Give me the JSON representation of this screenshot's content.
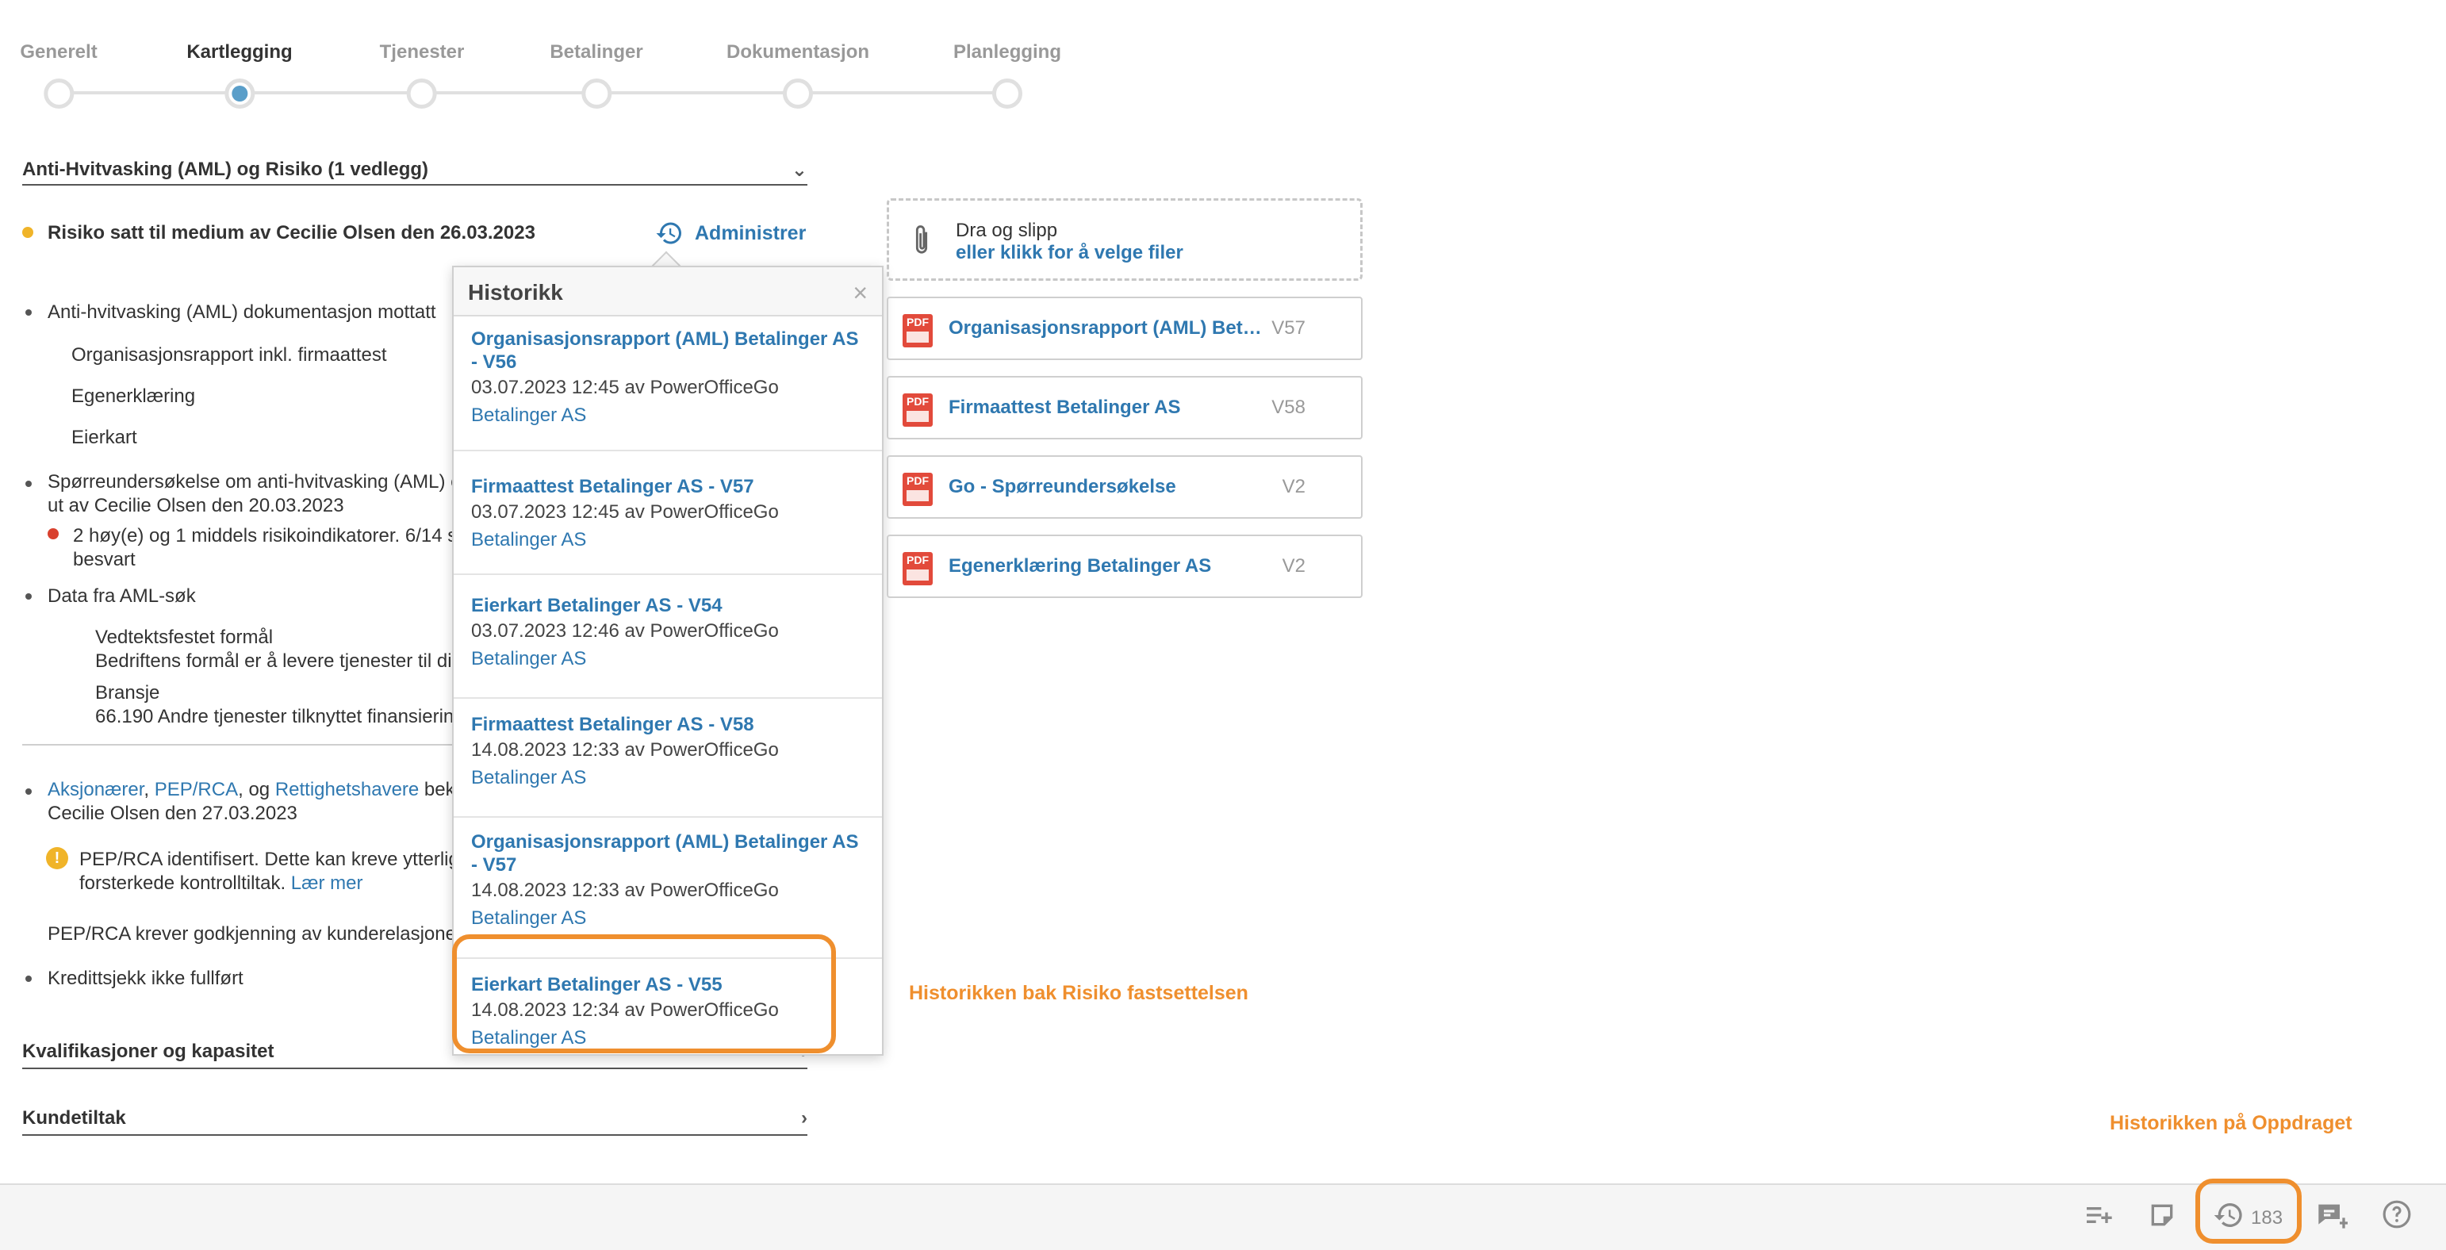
{
  "stepper": {
    "steps": [
      {
        "label": "Generelt"
      },
      {
        "label": "Kartlegging"
      },
      {
        "label": "Tjenester"
      },
      {
        "label": "Betalinger"
      },
      {
        "label": "Dokumentasjon"
      },
      {
        "label": "Planlegging"
      }
    ],
    "active_index": 1
  },
  "sections": {
    "aml_title": "Anti-Hvitvasking (AML) og Risiko (1 vedlegg)",
    "kvalifikasjoner_title": "Kvalifikasjoner og kapasitet",
    "kundetiltak_title": "Kundetiltak"
  },
  "risk": {
    "text": "Risiko satt til medium av Cecilie Olsen den 26.03.2023",
    "admin_label": "Administrer",
    "dot_color": "#f0b429"
  },
  "content": {
    "aml_doc": "Anti-hvitvasking (AML) dokumentasjon mottatt",
    "doc1": "Organisasjonsrapport inkl. firmaattest",
    "doc2": "Egenerklæring",
    "doc3": "Eierkart",
    "survey_line1": "Spørreundersøkelse om anti-hvitvasking (AML) e",
    "survey_line2": "ut av Cecilie Olsen den 20.03.2023",
    "risk_ind_line1": "2 høy(e) og 1 middels risikoindikatorer. 6/14 s",
    "risk_ind_line2": "besvart",
    "aml_search": "Data fra AML-søk",
    "purpose_label": "Vedtektsfestet formål",
    "purpose_value": "Bedriftens formål er å levere tjenester til di",
    "industry_label": "Bransje",
    "industry_value": "66.190 Andre tjenester tilknyttet finansierin",
    "owners_link1": "Aksjonærer",
    "owners_sep1": ", ",
    "owners_link2": "PEP/RCA",
    "owners_sep2": ", og ",
    "owners_link3": "Rettighetshavere",
    "owners_rest": " bek",
    "owners_line2": "Cecilie Olsen den 27.03.2023",
    "pep_warning_line1": "PEP/RCA identifisert. Dette kan kreve ytterlig",
    "pep_warning_line2": "forsterkede kontrolltiltak.",
    "pep_learn_more": "Lær mer",
    "pep_approval": "PEP/RCA krever godkjenning av kunderelasjone",
    "credit_check": "Kredittsjekk ikke fullført"
  },
  "history_popover": {
    "title": "Historikk",
    "items": [
      {
        "title_line1": "Organisasjonsrapport (AML) Betalinger AS",
        "title_line2": "- V56",
        "meta": "03.07.2023 12:45 av PowerOfficeGo",
        "link": "Betalinger AS"
      },
      {
        "title_line1": "Firmaattest Betalinger AS - V57",
        "title_line2": "",
        "meta": "03.07.2023 12:45 av PowerOfficeGo",
        "link": "Betalinger AS"
      },
      {
        "title_line1": "Eierkart Betalinger AS - V54",
        "title_line2": "",
        "meta": "03.07.2023 12:46 av PowerOfficeGo",
        "link": "Betalinger AS"
      },
      {
        "title_line1": "Firmaattest Betalinger AS - V58",
        "title_line2": "",
        "meta": "14.08.2023 12:33 av PowerOfficeGo",
        "link": "Betalinger AS"
      },
      {
        "title_line1": "Organisasjonsrapport (AML) Betalinger AS",
        "title_line2": "- V57",
        "meta": "14.08.2023 12:33 av PowerOfficeGo",
        "link": "Betalinger AS"
      },
      {
        "title_line1": "Eierkart Betalinger AS - V55",
        "title_line2": "",
        "meta": "14.08.2023 12:34 av PowerOfficeGo",
        "link": "Betalinger AS"
      }
    ]
  },
  "dropzone": {
    "line1": "Dra og slipp",
    "line2": "eller klikk for å velge filer"
  },
  "files": [
    {
      "name": "Organisasjonsrapport (AML) Betalinger AS",
      "version": "V57"
    },
    {
      "name": "Firmaattest Betalinger AS",
      "version": "V58"
    },
    {
      "name": "Go - Spørreundersøkelse",
      "version": "V2"
    },
    {
      "name": "Egenerklæring Betalinger AS",
      "version": "V2"
    }
  ],
  "annotations": {
    "risk_history": "Historikken bak Risiko fastsettelsen",
    "assignment_history": "Historikken på Oppdraget",
    "highlight_color": "#ef8f2e"
  },
  "bottombar": {
    "history_count": "183",
    "icons": [
      "add-list-icon",
      "note-icon",
      "history-icon",
      "add-comment-icon",
      "help-icon"
    ]
  }
}
